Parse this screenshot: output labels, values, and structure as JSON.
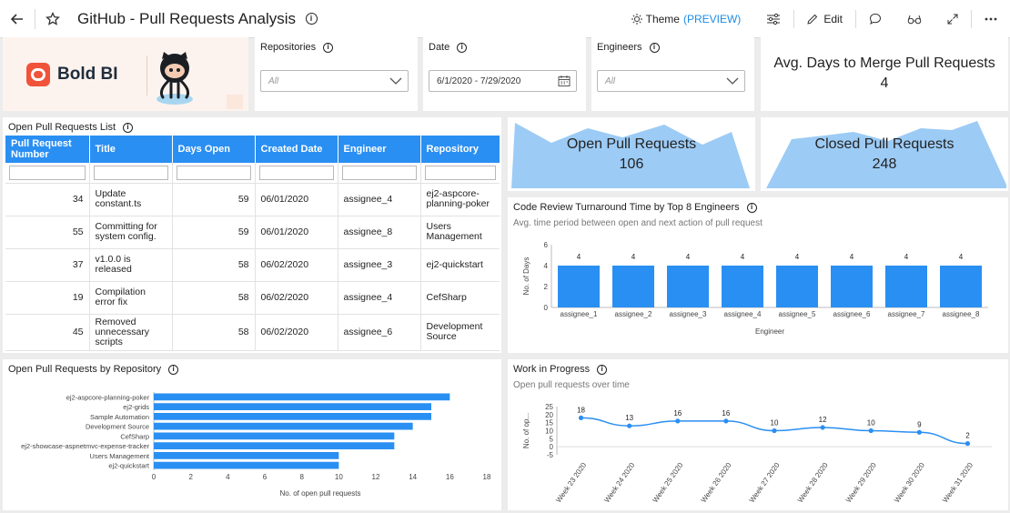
{
  "header": {
    "title": "GitHub - Pull Requests Analysis",
    "theme_label": "Theme",
    "theme_badge": "(PREVIEW)",
    "edit_label": "Edit"
  },
  "logo": {
    "brand_text": "Bold BI"
  },
  "filters": [
    {
      "label": "Repositories",
      "value": "All",
      "is_placeholder": true
    },
    {
      "label": "Date",
      "value": "6/1/2020 - 7/29/2020",
      "is_placeholder": false
    },
    {
      "label": "Engineers",
      "value": "All",
      "is_placeholder": true
    }
  ],
  "kpis": {
    "avg_days": {
      "label": "Avg. Days to Merge Pull Requests",
      "value": "4"
    },
    "open": {
      "label": "Open Pull Requests",
      "value": "106"
    },
    "closed": {
      "label": "Closed Pull Requests",
      "value": "248"
    }
  },
  "open_list": {
    "title": "Open Pull Requests List",
    "columns": [
      "Pull Request Number",
      "Title",
      "Days Open",
      "Created Date",
      "Engineer",
      "Repository"
    ],
    "rows": [
      [
        "34",
        "Update constant.ts",
        "59",
        "06/01/2020",
        "assignee_4",
        "ej2-aspcore-planning-poker"
      ],
      [
        "55",
        "Committing for system config.",
        "59",
        "06/01/2020",
        "assignee_8",
        "Users Management"
      ],
      [
        "37",
        "v1.0.0 is released",
        "58",
        "06/02/2020",
        "assignee_3",
        "ej2-quickstart"
      ],
      [
        "19",
        "Compilation error fix",
        "58",
        "06/02/2020",
        "assignee_4",
        "CefSharp"
      ],
      [
        "45",
        "Removed unnecessary scripts",
        "58",
        "06/02/2020",
        "assignee_6",
        "Development Source"
      ]
    ]
  },
  "review_chart": {
    "title": "Code Review Turnaround Time by Top 8 Engineers",
    "subtitle": "Avg. time period between open and next action of pull request"
  },
  "repo_chart": {
    "title": "Open Pull Requests by Repository"
  },
  "wip_chart": {
    "title": "Work in Progress",
    "subtitle": "Open pull requests over time"
  },
  "chart_data": [
    {
      "id": "review",
      "type": "bar",
      "categories": [
        "assignee_1",
        "assignee_2",
        "assignee_3",
        "assignee_4",
        "assignee_5",
        "assignee_6",
        "assignee_7",
        "assignee_8"
      ],
      "values": [
        4,
        4,
        4,
        4,
        4,
        4,
        4,
        4
      ],
      "xlabel": "Engineer",
      "ylabel": "No. of Days",
      "ylim": [
        0,
        6
      ],
      "yticks": [
        0,
        2,
        4,
        6
      ],
      "data_labels": true,
      "color": "#2a8ff2"
    },
    {
      "id": "repo",
      "type": "bar",
      "orientation": "horizontal",
      "categories": [
        "ej2-aspcore-planning-poker",
        "ej2-grids",
        "Sample Automation",
        "Development Source",
        "CefSharp",
        "ej2-showcase-aspnetmvc-expense-tracker",
        "Users Management",
        "ej2-quickstart"
      ],
      "values": [
        16,
        15,
        15,
        14,
        13,
        13,
        10,
        10
      ],
      "xlabel": "No. of open pull requests",
      "xlim": [
        0,
        18
      ],
      "xticks": [
        0,
        2,
        4,
        6,
        8,
        10,
        12,
        14,
        16,
        18
      ],
      "color": "#2a8ff2"
    },
    {
      "id": "wip",
      "type": "line",
      "categories": [
        "Week 23 2020",
        "Week 24 2020",
        "Week 25 2020",
        "Week 26 2020",
        "Week 27 2020",
        "Week 28 2020",
        "Week 29 2020",
        "Week 30 2020",
        "Week 31 2020"
      ],
      "values": [
        18,
        13,
        16,
        16,
        10,
        12,
        10,
        9,
        2
      ],
      "ylabel": "No. of op...",
      "ylim": [
        -5,
        25
      ],
      "yticks": [
        -5,
        0,
        5,
        10,
        15,
        20,
        25
      ],
      "data_labels": true,
      "color": "#2a8ff2"
    }
  ]
}
